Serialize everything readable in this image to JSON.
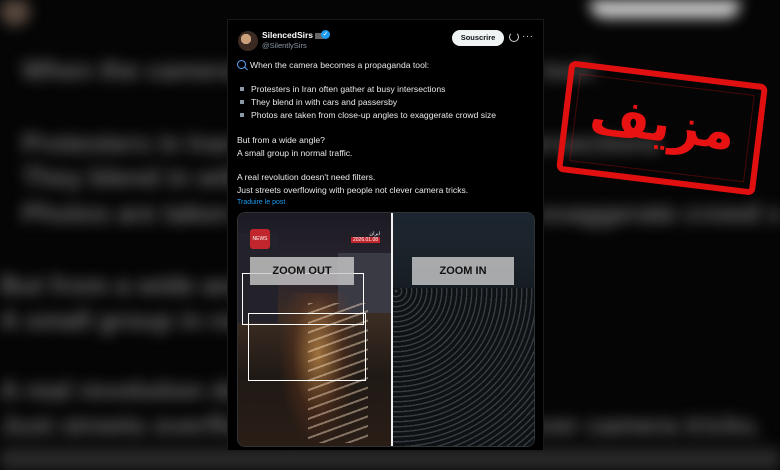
{
  "tweet": {
    "username": "SilencedSirs",
    "handle": "@SilentlySirs",
    "subscribe_label": "Souscrire",
    "more_label": "···",
    "intro": "When the camera becomes a propaganda tool:",
    "bullets": [
      "Protesters in Iran often gather at busy intersections",
      "They blend in with cars and passersby",
      "Photos are taken from close-up angles to exaggerate crowd size"
    ],
    "para2_line1": "But from a wide angle?",
    "para2_line2": "A small group in normal traffic.",
    "para3_line1": "A real revolution doesn't need filters.",
    "para3_line2": "Just streets overflowing with people not clever camera tricks.",
    "translate_label": "Traduire le post"
  },
  "media": {
    "zoom_out_label": "ZOOM OUT",
    "zoom_in_label": "ZOOM IN",
    "date_tag_top": "ایران",
    "date_tag_date": "2026.01.08"
  },
  "stamp": {
    "text": "مزيف",
    "color": "#e01010"
  },
  "icons": [
    "avatar",
    "verified-badge-icon",
    "grok-icon",
    "more-icon",
    "magnifier-icon",
    "news-logo"
  ]
}
